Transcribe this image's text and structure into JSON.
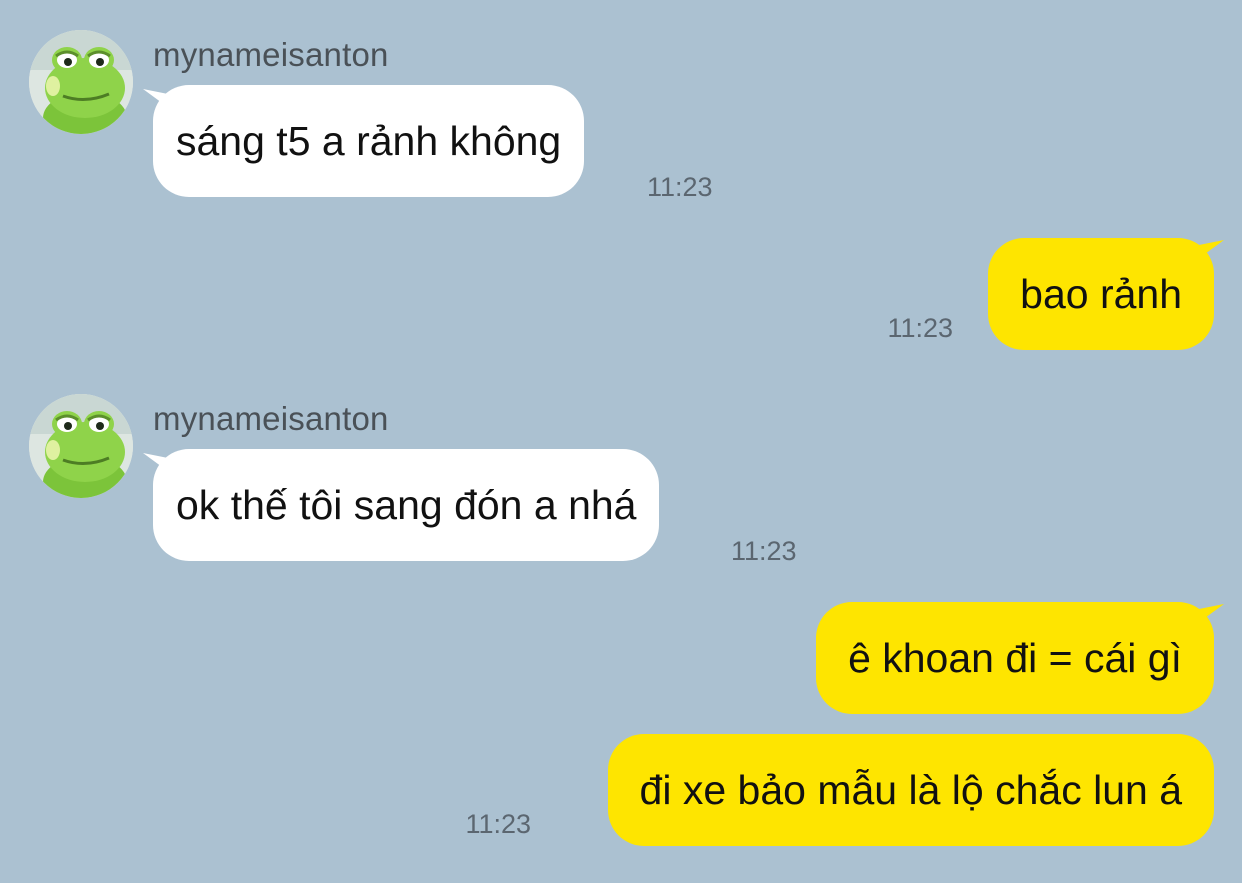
{
  "conversation": {
    "messages": [
      {
        "sender": "mynameisanton",
        "text": "sáng t5 a rảnh không",
        "time": "11:23"
      },
      {
        "text": "bao rảnh",
        "time": "11:23"
      },
      {
        "sender": "mynameisanton",
        "text": "ok thế tôi sang đón a nhá",
        "time": "11:23"
      },
      {
        "text": "ê khoan đi = cái gì"
      },
      {
        "text": "đi xe bảo mẫu là lộ chắc lun á",
        "time": "11:23"
      }
    ]
  },
  "icons": {
    "avatar": "green-dinosaur-avatar"
  },
  "colors": {
    "background": "#abc1d1",
    "incoming_bubble": "#ffffff",
    "outgoing_bubble": "#fee500",
    "timestamp": "#5b6670",
    "sender_name": "#4a5157"
  }
}
